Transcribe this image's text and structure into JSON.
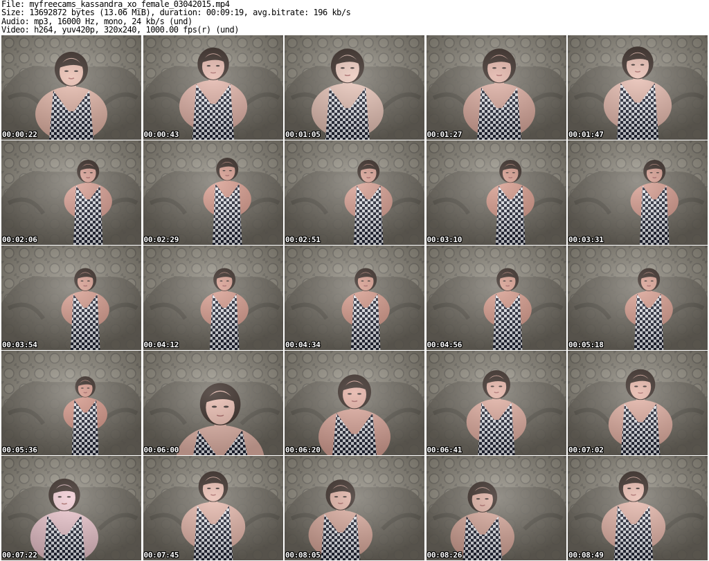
{
  "header": {
    "file_line": "File: myfreecams_kassandra_xo_female_03042015.mp4",
    "size_line": "Size: 13692872 bytes (13.06 MiB), duration: 00:09:19, avg.bitrate: 196 kb/s",
    "audio_line": "Audio: mp3, 16000 Hz, mono, 24 kb/s (und)",
    "video_line": "Video: h264, yuv420p, 320x240, 1000.00 fps(r) (und)"
  },
  "colors": {
    "background": "#ffffff",
    "header_text": "#000000",
    "timestamp_text": "#ffffff",
    "timestamp_outline": "#000000"
  },
  "thumbnails": [
    "00:00:22",
    "00:00:43",
    "00:01:05",
    "00:01:27",
    "00:01:47",
    "00:02:06",
    "00:02:29",
    "00:02:51",
    "00:03:10",
    "00:03:31",
    "00:03:54",
    "00:04:12",
    "00:04:34",
    "00:04:56",
    "00:05:18",
    "00:05:36",
    "00:06:00",
    "00:06:20",
    "00:06:41",
    "00:07:02",
    "00:07:22",
    "00:07:45",
    "00:08:05",
    "00:08:26",
    "00:08:49"
  ]
}
